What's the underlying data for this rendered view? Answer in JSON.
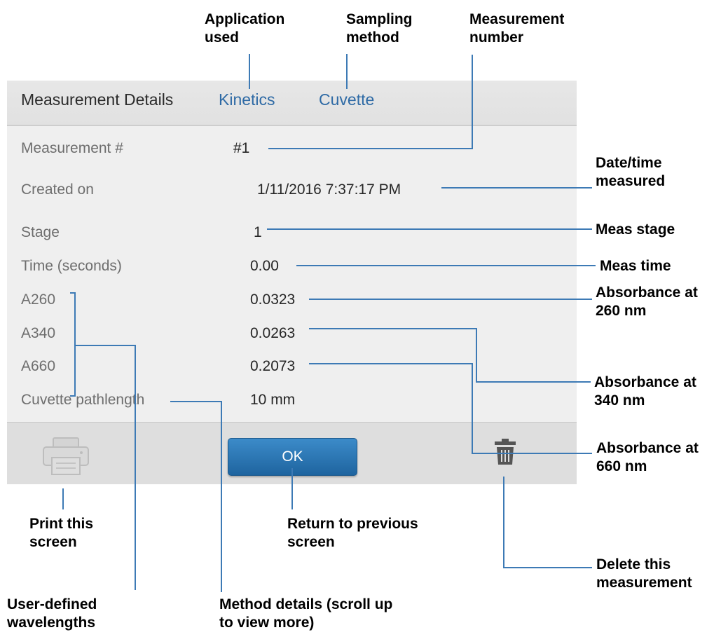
{
  "header": {
    "title": "Measurement Details",
    "application": "Kinetics",
    "sampling_method": "Cuvette"
  },
  "details": [
    {
      "label": "Measurement #",
      "value": "#1"
    },
    {
      "label": "Created on",
      "value": "1/11/2016 7:37:17 PM"
    },
    {
      "label": "Stage",
      "value": "1"
    },
    {
      "label": "Time (seconds)",
      "value": "0.00"
    },
    {
      "label": "A260",
      "value": "0.0323"
    },
    {
      "label": "A340",
      "value": "0.0263"
    },
    {
      "label": "A660",
      "value": "0.2073"
    },
    {
      "label": "Cuvette pathlength",
      "value": "10 mm"
    }
  ],
  "footer": {
    "ok_label": "OK",
    "print_icon": "printer-icon",
    "delete_icon": "trash-icon"
  },
  "callouts": {
    "application_used": "Application\nused",
    "sampling_method": "Sampling\nmethod",
    "measurement_number": "Measurement\nnumber",
    "date_time": "Date/time\nmeasured",
    "meas_stage": "Meas stage",
    "meas_time": "Meas time",
    "abs_260": "Absorbance at\n260 nm",
    "abs_340": "Absorbance at\n340 nm",
    "abs_660": "Absorbance at\n660 nm",
    "print_screen": "Print this\nscreen",
    "return_previous": "Return to previous\nscreen",
    "delete_measurement": "Delete this\nmeasurement",
    "user_wavelengths": "User-defined\nwavelengths",
    "method_details": "Method details (scroll up\nto view more)"
  },
  "colors": {
    "link_blue": "#2e6aa5",
    "callout_line": "#3d7ab5",
    "button_blue": "#2a78b8"
  }
}
